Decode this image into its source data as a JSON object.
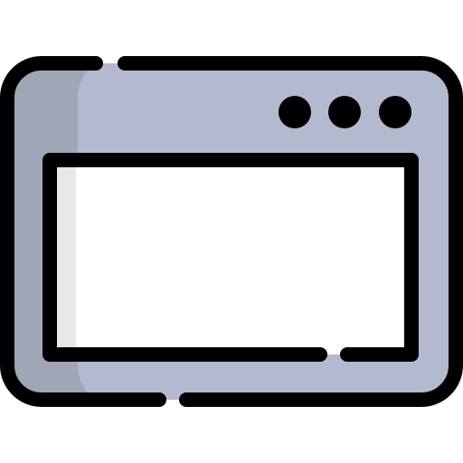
{
  "icon": {
    "name": "browser-window-icon",
    "colors": {
      "frame_fill": "#B3B9CE",
      "frame_shadow": "#A1A6B7",
      "content_fill": "#FFFFFF",
      "content_shadow": "#E8E8E8",
      "outline": "#000000"
    },
    "window_control_dots": [
      {
        "name": "window-dot-1-icon"
      },
      {
        "name": "window-dot-2-icon"
      },
      {
        "name": "window-dot-3-icon"
      }
    ]
  }
}
